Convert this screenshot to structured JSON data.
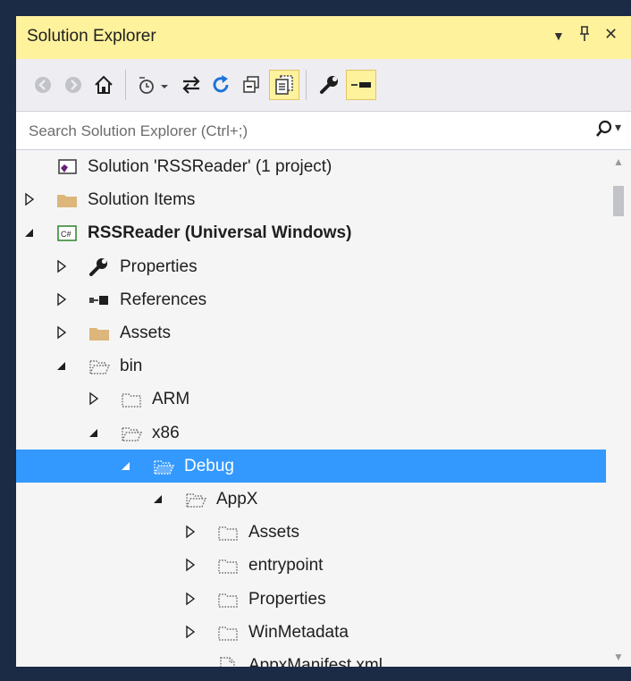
{
  "window": {
    "title": "Solution Explorer",
    "controls": [
      "dropdown",
      "pin",
      "close"
    ]
  },
  "toolbar": {
    "buttons": [
      "back-icon",
      "forward-icon",
      "home-icon",
      "pending-changes-icon",
      "sync-icon",
      "refresh-icon",
      "collapse-all-icon",
      "show-all-files-icon",
      "properties-icon",
      "preview-icon"
    ]
  },
  "search": {
    "placeholder": "Search Solution Explorer (Ctrl+;)"
  },
  "tree": [
    {
      "label": "Solution 'RSSReader' (1 project)",
      "level": 0,
      "icon": "solution-icon",
      "expander": "none"
    },
    {
      "label": "Solution Items",
      "level": 0,
      "icon": "folder-icon",
      "expander": "collapsed"
    },
    {
      "label": "RSSReader (Universal Windows)",
      "level": 0,
      "icon": "csharp-project-icon",
      "expander": "expanded",
      "bold": true
    },
    {
      "label": "Properties",
      "level": 1,
      "icon": "wrench-icon",
      "expander": "collapsed"
    },
    {
      "label": "References",
      "level": 1,
      "icon": "references-icon",
      "expander": "collapsed"
    },
    {
      "label": "Assets",
      "level": 1,
      "icon": "folder-icon",
      "expander": "collapsed"
    },
    {
      "label": "bin",
      "level": 1,
      "icon": "open-dashed-folder-icon",
      "expander": "expanded"
    },
    {
      "label": "ARM",
      "level": 2,
      "icon": "dashed-folder-icon",
      "expander": "collapsed"
    },
    {
      "label": "x86",
      "level": 2,
      "icon": "open-dashed-folder-icon",
      "expander": "expanded"
    },
    {
      "label": "Debug",
      "level": 3,
      "icon": "open-dashed-folder-icon",
      "expander": "expanded",
      "selected": true
    },
    {
      "label": "AppX",
      "level": 4,
      "icon": "open-dashed-folder-icon",
      "expander": "expanded"
    },
    {
      "label": "Assets",
      "level": 5,
      "icon": "dashed-folder-icon",
      "expander": "collapsed"
    },
    {
      "label": "entrypoint",
      "level": 5,
      "icon": "dashed-folder-icon",
      "expander": "collapsed"
    },
    {
      "label": "Properties",
      "level": 5,
      "icon": "dashed-folder-icon",
      "expander": "collapsed"
    },
    {
      "label": "WinMetadata",
      "level": 5,
      "icon": "dashed-folder-icon",
      "expander": "collapsed"
    },
    {
      "label": "AppxManifest.xml",
      "level": 5,
      "icon": "dashed-file-icon",
      "expander": "none"
    },
    {
      "label": "",
      "level": 5,
      "icon": "dashed-file-icon",
      "expander": "none"
    }
  ],
  "colors": {
    "titlebar": "#fff29d",
    "selection": "#3399ff",
    "folder": "#dcb67a",
    "vs_purple": "#68217a",
    "csharp_green": "#388a34"
  }
}
